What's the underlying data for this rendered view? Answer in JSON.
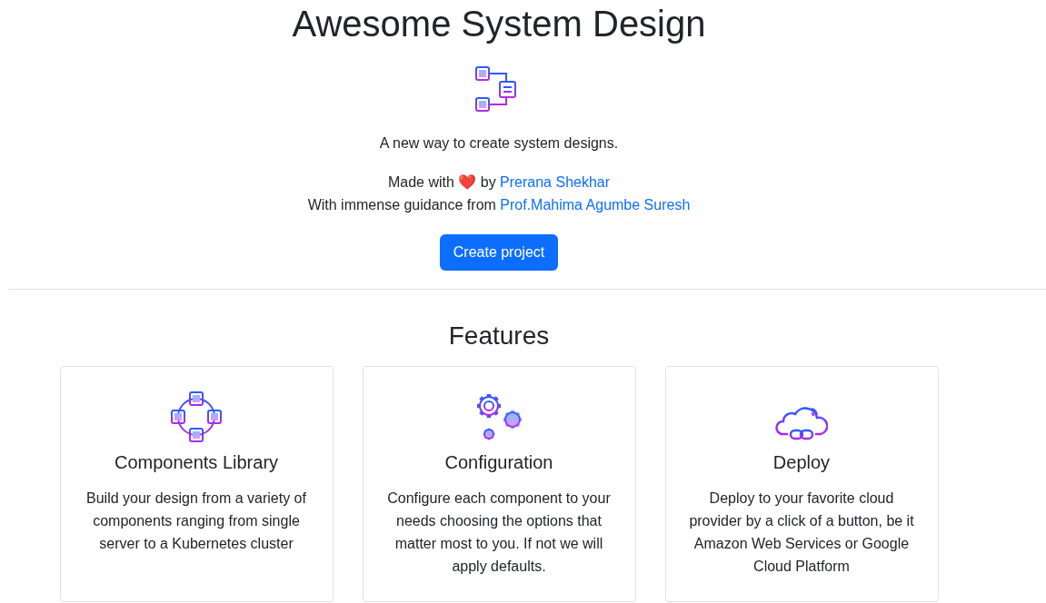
{
  "title": "Awesome System Design",
  "tagline": "A new way to create system designs.",
  "credits": [
    {
      "text": "Made with ❤️ by",
      "link": "Prerana Shekhar"
    },
    {
      "text": "With immense guidance from",
      "link": "Prof.Mahima Agumbe Suresh"
    }
  ],
  "button": "Create project",
  "features": {
    "heading": "Features",
    "cards": [
      {
        "kind": "components",
        "title": "Components Library",
        "text": "Build your design from a variety of components ranging from single server to a Kubernetes cluster"
      },
      {
        "kind": "gears",
        "title": "Configuration",
        "text": "Configure each component to your needs choosing the options that matter most to you. If not we will apply defaults."
      },
      {
        "kind": "cloud",
        "title": "Deploy",
        "text": "Deploy to your favorite cloud provider by a click of a button, be it Amazon Web Services or Google Cloud Platform"
      }
    ]
  }
}
